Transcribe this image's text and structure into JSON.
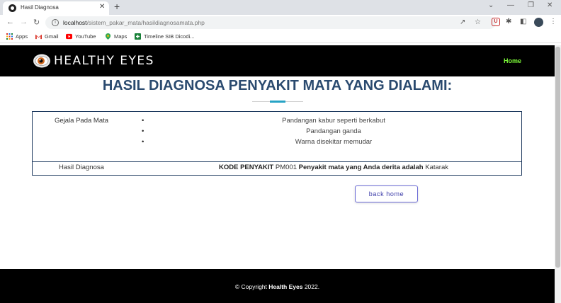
{
  "browser": {
    "tab_title": "Hasil Diagnosa",
    "tab_close": "✕",
    "new_tab": "+",
    "win_minimize": "—",
    "win_restore": "❐",
    "win_close": "✕",
    "win_chevron": "⌄",
    "url_host": "localhost",
    "url_path": "/sistem_pakar_mata/hasildiagnosamata.php",
    "bookmarks": [
      "Apps",
      "Gmail",
      "YouTube",
      "Maps",
      "Timeline SIB Dicodi..."
    ],
    "colors": {
      "ext_icon": "#c62828",
      "tabstrip": "#dee1e6"
    }
  },
  "header": {
    "brand": "HEALTHY EYES",
    "nav_home": "Home",
    "colors": {
      "nav_home": "#7fff3a",
      "bar": "#000000"
    }
  },
  "main": {
    "title": "HASIL DIAGNOSA PENYAKIT MATA YANG DIALAMI:",
    "symptoms_label": "Gejala Pada Mata",
    "symptoms": [
      "Pandangan kabur seperti berkabut",
      "Pandangan ganda",
      "Warna disekitar memudar"
    ],
    "diagnosis_label": "Hasil Diagnosa",
    "diagnosis": {
      "code_label": "KODE PENYAKIT",
      "code": "PM001",
      "sentence": "Penyakit mata yang Anda derita adalah",
      "disease": "Katarak"
    },
    "back_button": "back home",
    "colors": {
      "title": "#2a4a6f",
      "accent_line": "#26a3c5",
      "table_border": "#1e3a5f"
    }
  },
  "footer": {
    "prefix": "© Copyright ",
    "brand": "Health Eyes",
    "suffix": " 2022."
  }
}
